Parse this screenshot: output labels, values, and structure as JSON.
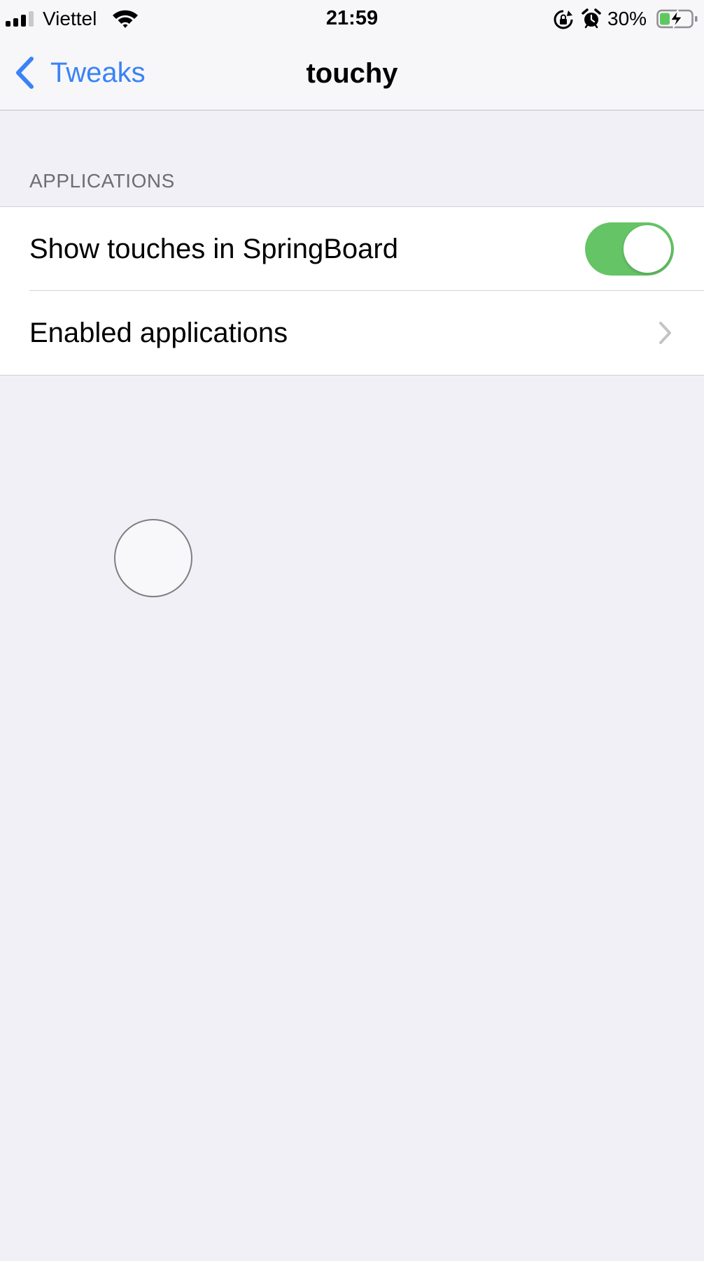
{
  "status_bar": {
    "carrier": "Viettel",
    "time": "21:59",
    "battery_percent": "30%",
    "signal_bars_filled": 3,
    "signal_bars_total": 4,
    "battery_level": 0.3,
    "battery_charging": true,
    "icons": [
      "signal-icon",
      "wifi-icon",
      "orientation-lock-icon",
      "alarm-icon",
      "battery-icon"
    ]
  },
  "nav": {
    "back_label": "Tweaks",
    "title": "touchy"
  },
  "section": {
    "header": "APPLICATIONS",
    "rows": [
      {
        "label": "Show touches in SpringBoard",
        "control": "toggle",
        "on": true
      },
      {
        "label": "Enabled applications",
        "control": "disclosure"
      }
    ]
  },
  "colors": {
    "accent": "#3a82f7",
    "toggle_on": "#65c466",
    "background": "#f0f0f6",
    "section_header": "#6d6d72"
  }
}
